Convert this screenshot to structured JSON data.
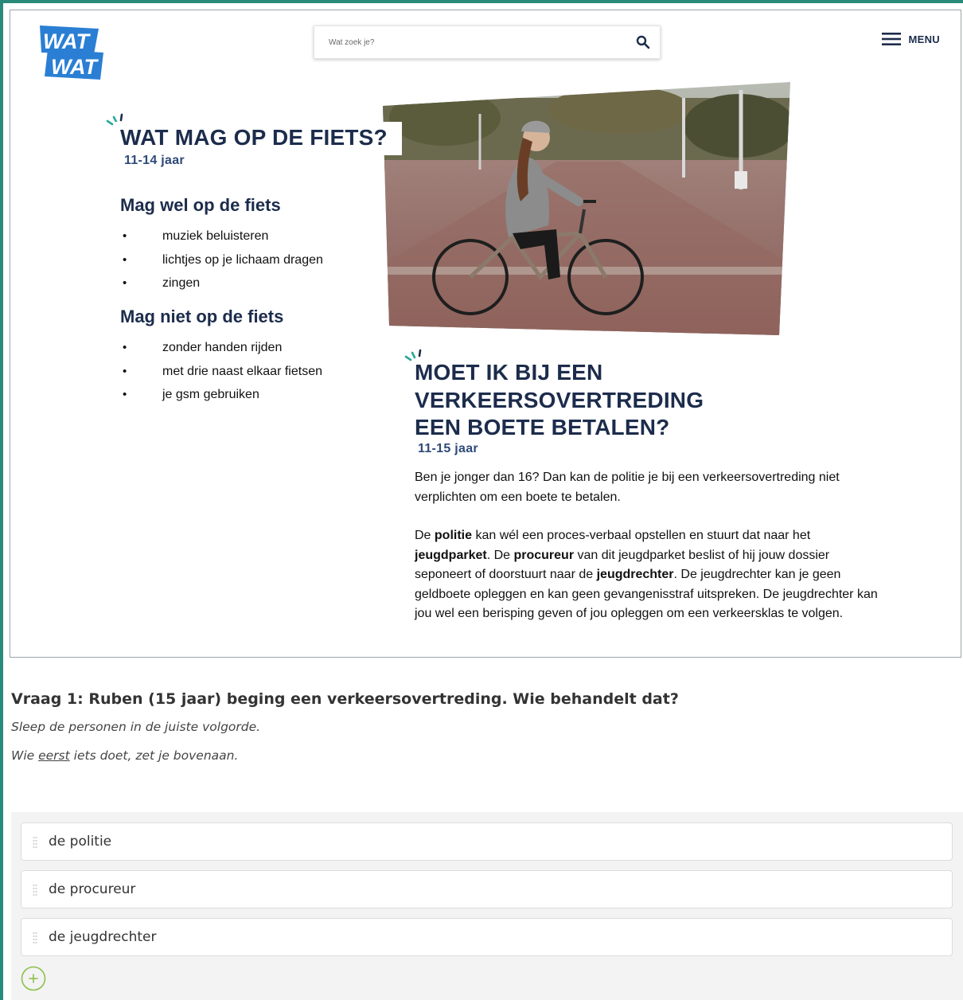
{
  "header": {
    "logo_text": [
      "WAT",
      "WAT"
    ],
    "search_placeholder": "Wat zoek je?",
    "menu_label": "MENU"
  },
  "section1": {
    "title": "WAT MAG OP DE FIETS?",
    "age": "11-14 jaar",
    "allowed": {
      "heading": "Mag wel op de fiets",
      "items": [
        "muziek beluisteren",
        "lichtjes op je lichaam dragen",
        "zingen"
      ]
    },
    "not_allowed": {
      "heading": "Mag niet op de fiets",
      "items": [
        "zonder handen rijden",
        "met drie naast elkaar fietsen",
        "je gsm gebruiken"
      ]
    }
  },
  "section2": {
    "title_lines": [
      "MOET IK BIJ EEN",
      "VERKEERSOVERTREDING",
      "EEN BOETE BETALEN?"
    ],
    "age": "11-15 jaar",
    "p1": "Ben je jonger dan 16? Dan kan de politie je bij een verkeersovertreding niet verplichten om een boete te betalen.",
    "p2": {
      "t1": "De ",
      "b1": "politie",
      "t2": " kan wél een proces-verbaal opstellen en stuurt dat naar het ",
      "b2": "jeugdparket",
      "t3": ". De ",
      "b3": "procureur",
      "t4": " van dit jeugdparket beslist of hij jouw dossier seponeert of doorstuurt naar de ",
      "b4": "jeugdrechter",
      "t5": ". De jeugdrechter kan je geen geldboete opleggen en kan geen gevangenisstraf uitspreken. De jeugdrechter kan jou wel een berisping geven of jou opleggen om een verkeersklas te volgen."
    }
  },
  "question": {
    "title": "Vraag 1: Ruben (15 jaar) beging een verkeersovertreding. Wie behandelt dat?",
    "instruction1": "Sleep de personen in de juiste volgorde.",
    "instruction2_pre": "Wie ",
    "instruction2_u": "eerst",
    "instruction2_post": " iets doet, zet je bovenaan.",
    "items": [
      "de politie",
      "de procureur",
      "de jeugdrechter"
    ]
  },
  "colors": {
    "logo_blue": "#2a7fd4",
    "navy": "#1c2c4c",
    "accent_teal": "#2aa89a",
    "add_green": "#8dc04c"
  }
}
